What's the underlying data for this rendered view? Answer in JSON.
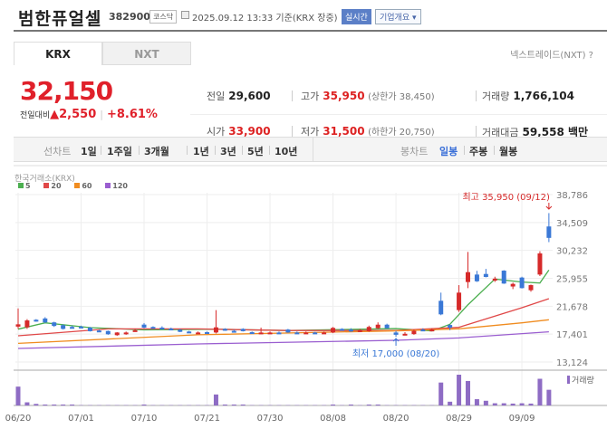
{
  "header": {
    "title": "범한퓨얼셀",
    "code": "382900",
    "market": "코스닥",
    "datetime": "2025.09.12 13:33  기준(KRX 장중)",
    "realtime_label": "실시간",
    "profile_label": "기업개요 ▾"
  },
  "tabs": [
    {
      "label": "KRX",
      "active": true
    },
    {
      "label": "NXT",
      "active": false
    }
  ],
  "nxt_link": "넥스트레이드(NXT) ?",
  "quote": {
    "price": "32,150",
    "change_label": "전일대비",
    "change": "▲2,550",
    "change_pct": "+8.61%"
  },
  "stats": {
    "prev_label": "전일",
    "prev": "29,600",
    "high_label": "고가",
    "high": "35,950",
    "upper_limit": "(상한가 38,450)",
    "volume_label": "거래량",
    "volume": "1,766,104",
    "open_label": "시가",
    "open": "33,900",
    "low_label": "저가",
    "low": "31,500",
    "lower_limit": "(하한가 20,750)",
    "amount_label": "거래대금",
    "amount": "59,558 백만"
  },
  "toolbar": {
    "line_label": "선차트",
    "line_periods": [
      "1일",
      "1주일",
      "3개월",
      "1년",
      "3년",
      "5년",
      "10년"
    ],
    "candle_label": "봉차트",
    "candle_periods": [
      "일봉",
      "주봉",
      "월봉"
    ],
    "active_candle": "일봉"
  },
  "chart_data": {
    "type": "candlestick",
    "exchange_label": "한국거래소(KRX)",
    "legend": [
      {
        "name": "5",
        "color": "#4caf50"
      },
      {
        "name": "20",
        "color": "#e04848"
      },
      {
        "name": "60",
        "color": "#f08c20"
      },
      {
        "name": "120",
        "color": "#9a5ed0"
      }
    ],
    "y_ticks": [
      "38,786",
      "34,509",
      "30,232",
      "25,955",
      "21,678",
      "17,401",
      "13,124"
    ],
    "ylim": [
      13124,
      38786
    ],
    "x_labels": [
      {
        "i": 0,
        "label": "06/20"
      },
      {
        "i": 7,
        "label": "07/01"
      },
      {
        "i": 14,
        "label": "07/10"
      },
      {
        "i": 21,
        "label": "07/21"
      },
      {
        "i": 28,
        "label": "07/30"
      },
      {
        "i": 35,
        "label": "08/08"
      },
      {
        "i": 42,
        "label": "08/20"
      },
      {
        "i": 49,
        "label": "08/29"
      },
      {
        "i": 56,
        "label": "09/09"
      }
    ],
    "candles": [
      [
        18550,
        21350,
        18200,
        18900
      ],
      [
        18440,
        19700,
        18200,
        19500
      ],
      [
        19600,
        19700,
        19300,
        19450
      ],
      [
        19800,
        20000,
        19100,
        19200
      ],
      [
        19200,
        19300,
        18500,
        18650
      ],
      [
        18760,
        18900,
        18100,
        18200
      ],
      [
        18500,
        18700,
        18300,
        18400
      ],
      [
        18550,
        18700,
        18350,
        18450
      ],
      [
        18400,
        18500,
        17800,
        17850
      ],
      [
        17950,
        18100,
        17800,
        17850
      ],
      [
        17880,
        17950,
        17300,
        17380
      ],
      [
        17240,
        17700,
        17150,
        17650
      ],
      [
        17500,
        17800,
        17300,
        17650
      ],
      [
        17900,
        18200,
        17800,
        18000
      ],
      [
        18860,
        19100,
        18300,
        18400
      ],
      [
        18500,
        18600,
        18300,
        18350
      ],
      [
        18400,
        18600,
        18200,
        18250
      ],
      [
        18250,
        18400,
        18000,
        18050
      ],
      [
        18070,
        18200,
        17700,
        17750
      ],
      [
        17800,
        17900,
        17600,
        17650
      ],
      [
        17650,
        17800,
        17550,
        17650
      ],
      [
        17700,
        17800,
        17550,
        17600
      ],
      [
        17650,
        21080,
        17500,
        18440
      ],
      [
        18200,
        18300,
        17900,
        17950
      ],
      [
        17900,
        18100,
        17700,
        17750
      ],
      [
        18200,
        18300,
        17800,
        17850
      ],
      [
        17700,
        17800,
        17550,
        17600
      ],
      [
        17600,
        18400,
        17450,
        17650
      ],
      [
        17600,
        17800,
        17500,
        17650
      ],
      [
        17650,
        17800,
        17500,
        17600
      ],
      [
        18100,
        18200,
        17600,
        17650
      ],
      [
        17650,
        17800,
        17500,
        17600
      ],
      [
        17600,
        17800,
        17500,
        17650
      ],
      [
        17650,
        17750,
        17500,
        17600
      ],
      [
        17600,
        17800,
        17500,
        17650
      ],
      [
        17650,
        18500,
        17550,
        18350
      ],
      [
        18200,
        18300,
        18000,
        18100
      ],
      [
        18100,
        18300,
        17750,
        17800
      ],
      [
        17800,
        18200,
        17700,
        18000
      ],
      [
        17850,
        18700,
        17750,
        18500
      ],
      [
        18300,
        19200,
        18200,
        18850
      ],
      [
        18850,
        19000,
        18250,
        18300
      ],
      [
        17650,
        17900,
        17000,
        17300
      ],
      [
        17350,
        17700,
        17300,
        17450
      ],
      [
        17400,
        18100,
        17300,
        17900
      ],
      [
        18100,
        18300,
        17900,
        18050
      ],
      [
        18050,
        18300,
        17900,
        18100
      ],
      [
        22510,
        23760,
        20300,
        20430
      ],
      [
        18800,
        18900,
        18000,
        18400
      ],
      [
        21080,
        24910,
        20800,
        23760
      ],
      [
        25380,
        30000,
        24450,
        26900
      ],
      [
        26530,
        27100,
        25400,
        25500
      ],
      [
        26620,
        27400,
        26100,
        26160
      ],
      [
        25600,
        26200,
        25400,
        25900
      ],
      [
        27130,
        27200,
        25100,
        25150
      ],
      [
        24700,
        25300,
        24300,
        25100
      ],
      [
        26070,
        26200,
        24400,
        24450
      ],
      [
        24130,
        25000,
        23900,
        24910
      ],
      [
        26530,
        30100,
        26300,
        29770
      ],
      [
        33900,
        35950,
        31500,
        32150
      ]
    ],
    "volume": [
      60,
      10,
      5,
      3,
      3,
      3,
      3,
      1,
      1,
      1,
      1,
      1,
      1,
      1,
      3,
      1,
      1,
      1,
      1,
      1,
      1,
      1,
      35,
      3,
      3,
      3,
      1,
      1,
      1,
      1,
      1,
      1,
      1,
      1,
      1,
      3,
      1,
      3,
      1,
      3,
      3,
      1,
      1,
      1,
      1,
      1,
      1,
      73,
      12,
      98,
      78,
      20,
      15,
      7,
      7,
      6,
      7,
      6,
      85,
      50
    ],
    "volume_label": "거래량",
    "moving_averages": [
      {
        "name": "5",
        "color": "#4caf50",
        "points": [
          [
            0,
            18160
          ],
          [
            3,
            19130
          ],
          [
            8,
            18400
          ],
          [
            14,
            18050
          ],
          [
            22,
            18150
          ],
          [
            30,
            17950
          ],
          [
            42,
            18250
          ],
          [
            46,
            17900
          ],
          [
            48,
            18900
          ],
          [
            50,
            21900
          ],
          [
            53,
            25840
          ],
          [
            56,
            25380
          ],
          [
            58,
            25240
          ],
          [
            59,
            27220
          ]
        ]
      },
      {
        "name": "20",
        "color": "#e04848",
        "points": [
          [
            0,
            17150
          ],
          [
            10,
            18200
          ],
          [
            20,
            18200
          ],
          [
            30,
            17950
          ],
          [
            42,
            17950
          ],
          [
            49,
            18440
          ],
          [
            56,
            21450
          ],
          [
            59,
            22830
          ]
        ]
      },
      {
        "name": "60",
        "color": "#f08c20",
        "points": [
          [
            0,
            15990
          ],
          [
            20,
            17300
          ],
          [
            42,
            17900
          ],
          [
            49,
            18210
          ],
          [
            56,
            19130
          ],
          [
            59,
            19600
          ]
        ]
      },
      {
        "name": "120",
        "color": "#9a5ed0",
        "points": [
          [
            0,
            15200
          ],
          [
            20,
            15900
          ],
          [
            42,
            16450
          ],
          [
            49,
            16820
          ],
          [
            59,
            17750
          ]
        ]
      }
    ],
    "max_annotation": {
      "i": 59,
      "label": "최고 35,950 (09/12)",
      "value": 35950
    },
    "min_annotation": {
      "i": 42,
      "label": "최저 17,000 (08/20)",
      "value": 17000
    }
  }
}
